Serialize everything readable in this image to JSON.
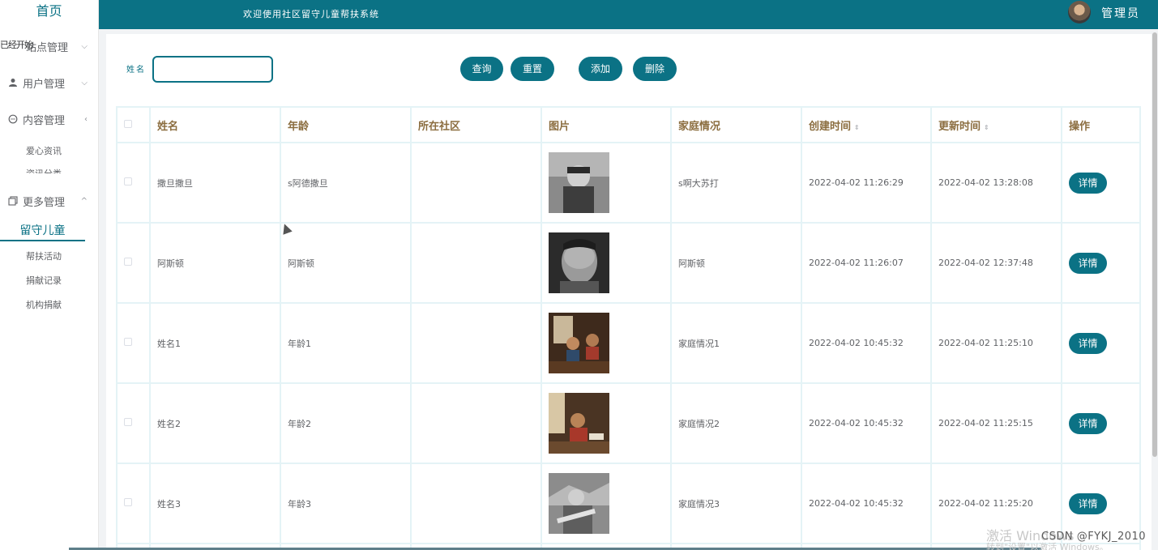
{
  "sidebar": {
    "home": "首页",
    "overlap_text": "已经开始",
    "menus": [
      {
        "label": "站点管理",
        "chevron": "⌵"
      },
      {
        "label": "用户管理",
        "chevron": "⌵"
      },
      {
        "label": "内容管理",
        "chevron": "‹"
      },
      {
        "label": "更多管理",
        "chevron": "^"
      }
    ],
    "content_subs": [
      "爱心资讯",
      "资讯分类"
    ],
    "more_active": "留守儿童",
    "more_subs": [
      "帮扶活动",
      "捐献记录",
      "机构捐献"
    ]
  },
  "header": {
    "welcome": "欢迎使用社区留守儿童帮扶系统",
    "admin": "管理员"
  },
  "search": {
    "label": "姓名",
    "placeholder": "",
    "value": ""
  },
  "buttons": {
    "query": "查询",
    "reset": "重置",
    "add": "添加",
    "delete": "删除"
  },
  "table": {
    "headers": [
      "姓名",
      "年龄",
      "所在社区",
      "图片",
      "家庭情况",
      "创建时间",
      "更新时间",
      "操作"
    ],
    "sort_glyph": "⇕",
    "detail_label": "详情",
    "rows": [
      {
        "name": "撒旦撒旦",
        "age": "s阿德撒旦",
        "community": "",
        "family": "s啊大苏打",
        "created": "2022-04-02 11:26:29",
        "updated": "2022-04-02 13:28:08"
      },
      {
        "name": "阿斯顿",
        "age": "阿斯顿",
        "community": "",
        "family": "阿斯顿",
        "created": "2022-04-02 11:26:07",
        "updated": "2022-04-02 12:37:48"
      },
      {
        "name": "姓名1",
        "age": "年龄1",
        "community": "",
        "family": "家庭情况1",
        "created": "2022-04-02 10:45:32",
        "updated": "2022-04-02 11:25:10"
      },
      {
        "name": "姓名2",
        "age": "年龄2",
        "community": "",
        "family": "家庭情况2",
        "created": "2022-04-02 10:45:32",
        "updated": "2022-04-02 11:25:15"
      },
      {
        "name": "姓名3",
        "age": "年龄3",
        "community": "",
        "family": "家庭情况3",
        "created": "2022-04-02 10:45:32",
        "updated": "2022-04-02 11:25:20"
      }
    ]
  },
  "watermark": {
    "line1": "激活 Windows",
    "line2": "转到\"设置\"以激活 Windows。",
    "csdn": "CSDN @FYKJ_2010"
  },
  "colors": {
    "primary": "#0b7285",
    "header_text": "#8b6d3f"
  }
}
